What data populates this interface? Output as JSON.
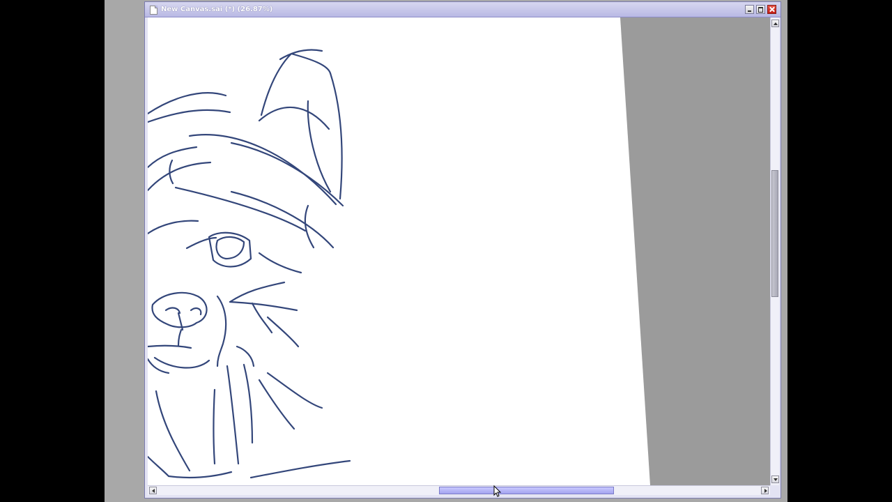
{
  "window": {
    "title": "New Canvas.sai (*) (26.87%)",
    "accent_color": "#b9b9e4"
  },
  "titlebar_buttons": {
    "minimize_icon": "minimize-icon",
    "maximize_icon": "maximize-icon",
    "close_icon": "close-icon"
  },
  "canvas": {
    "background_color": "#9b9b9b",
    "paper_color": "#ffffff",
    "line_color": "#33467a",
    "content": "sketch"
  },
  "scrollbars": {
    "vertical": {
      "position": 0.42
    },
    "horizontal": {
      "position": 0.55
    }
  }
}
